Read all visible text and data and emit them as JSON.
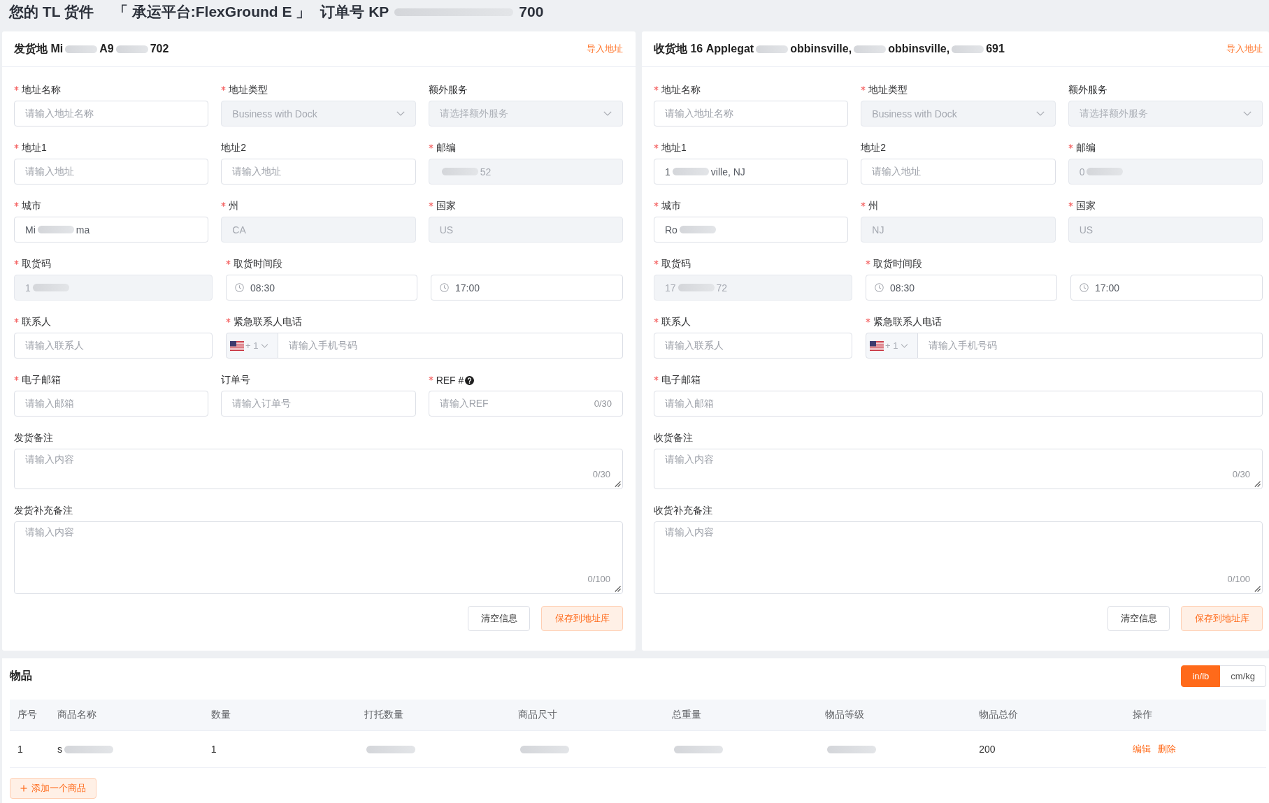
{
  "title": [
    {
      "kind": "text",
      "text": "您的 TL 货件"
    },
    {
      "kind": "text",
      "text": "「 承运平台:FlexGround E 」"
    },
    {
      "kind": "text",
      "text": "订单号 KP"
    },
    {
      "kind": "smear"
    },
    {
      "kind": "text",
      "text": "700"
    }
  ],
  "panels": [
    {
      "header": [
        {
          "kind": "text",
          "text": "发货地 Mi"
        },
        {
          "kind": "smear"
        },
        {
          "kind": "text",
          "text": "A9"
        },
        {
          "kind": "smear"
        },
        {
          "kind": "text",
          "text": "702"
        }
      ],
      "import_link": "导入地址",
      "rows": [
        [
          {
            "kind": "input",
            "label": "地址名称",
            "required": true,
            "disabled": false,
            "placeholder": "请输入地址名称"
          },
          {
            "kind": "select",
            "label": "地址类型",
            "required": true,
            "disabled": true,
            "value": "Business with Dock"
          },
          {
            "kind": "select",
            "label": "额外服务",
            "required": false,
            "disabled": true,
            "placeholder": "请选择额外服务"
          }
        ],
        [
          {
            "kind": "input",
            "label": "地址1",
            "required": true,
            "disabled": false,
            "placeholder": "请输入地址"
          },
          {
            "kind": "input",
            "label": "地址2",
            "required": false,
            "disabled": false,
            "placeholder": "请输入地址"
          },
          {
            "kind": "input",
            "label": "邮编",
            "required": true,
            "disabled": true,
            "value": [
              {
                "kind": "smear"
              },
              {
                "kind": "text",
                "text": "52"
              }
            ]
          }
        ],
        [
          {
            "kind": "input",
            "label": "城市",
            "required": true,
            "disabled": false,
            "value": [
              {
                "kind": "text",
                "text": "Mi"
              },
              {
                "kind": "smear"
              },
              {
                "kind": "text",
                "text": "ma"
              }
            ]
          },
          {
            "kind": "input",
            "label": "州",
            "required": true,
            "disabled": true,
            "value": "CA"
          },
          {
            "kind": "input",
            "label": "国家",
            "required": true,
            "disabled": true,
            "value": "US"
          }
        ],
        [
          {
            "kind": "input",
            "label": "取货码",
            "required": true,
            "disabled": true,
            "value": [
              {
                "kind": "text",
                "text": "1"
              },
              {
                "kind": "smear"
              }
            ]
          },
          {
            "kind": "time",
            "label": "取货时间段",
            "required": true,
            "disabled": false,
            "value": "08:30"
          },
          {
            "kind": "time",
            "disabled": false,
            "value": "17:00"
          }
        ],
        [
          {
            "kind": "input",
            "label": "联系人",
            "required": true,
            "disabled": false,
            "placeholder": "请输入联系人"
          },
          {
            "kind": "phone",
            "label": "紧急联系人电话",
            "required": true,
            "disabled": false,
            "code": "+ 1",
            "placeholder": "请输入手机号码"
          }
        ],
        [
          {
            "kind": "input",
            "label": "电子邮箱",
            "required": true,
            "disabled": false,
            "placeholder": "请输入邮箱"
          },
          {
            "kind": "input",
            "label": "订单号",
            "required": false,
            "disabled": false,
            "placeholder": "请输入订单号"
          },
          {
            "kind": "input",
            "label": "REF #",
            "required": true,
            "help": true,
            "disabled": false,
            "placeholder": "请输入REF",
            "counter": "0/30"
          }
        ]
      ],
      "notes": [
        {
          "label": "发货备注",
          "placeholder": "请输入内容",
          "counter": "0/30"
        },
        {
          "label": "发货补充备注",
          "placeholder": "请输入内容",
          "counter": "0/100"
        }
      ],
      "buttons": [
        {
          "kind": "clear",
          "label": "清空信息"
        },
        {
          "kind": "save",
          "label": "保存到地址库"
        }
      ]
    },
    {
      "header": [
        {
          "kind": "text",
          "text": "收货地 16 Applegat"
        },
        {
          "kind": "smear"
        },
        {
          "kind": "text",
          "text": "obbinsville,"
        },
        {
          "kind": "smear"
        },
        {
          "kind": "text",
          "text": "obbinsville,"
        },
        {
          "kind": "smear"
        },
        {
          "kind": "text",
          "text": "691"
        }
      ],
      "import_link": "导入地址",
      "rows": [
        [
          {
            "kind": "input",
            "label": "地址名称",
            "required": true,
            "disabled": false,
            "placeholder": "请输入地址名称"
          },
          {
            "kind": "select",
            "label": "地址类型",
            "required": true,
            "disabled": true,
            "value": "Business with Dock"
          },
          {
            "kind": "select",
            "label": "额外服务",
            "required": false,
            "disabled": true,
            "placeholder": "请选择额外服务"
          }
        ],
        [
          {
            "kind": "input",
            "label": "地址1",
            "required": true,
            "disabled": false,
            "value": [
              {
                "kind": "text",
                "text": "1"
              },
              {
                "kind": "smear"
              },
              {
                "kind": "text",
                "text": "ville, NJ"
              }
            ]
          },
          {
            "kind": "input",
            "label": "地址2",
            "required": false,
            "disabled": false,
            "placeholder": "请输入地址"
          },
          {
            "kind": "input",
            "label": "邮编",
            "required": true,
            "disabled": true,
            "value": [
              {
                "kind": "text",
                "text": "0"
              },
              {
                "kind": "smear"
              }
            ]
          }
        ],
        [
          {
            "kind": "input",
            "label": "城市",
            "required": true,
            "disabled": false,
            "value": [
              {
                "kind": "text",
                "text": "Ro"
              },
              {
                "kind": "smear"
              }
            ]
          },
          {
            "kind": "input",
            "label": "州",
            "required": true,
            "disabled": true,
            "value": "NJ"
          },
          {
            "kind": "input",
            "label": "国家",
            "required": true,
            "disabled": true,
            "value": "US"
          }
        ],
        [
          {
            "kind": "input",
            "label": "取货码",
            "required": true,
            "disabled": true,
            "value": [
              {
                "kind": "text",
                "text": "17"
              },
              {
                "kind": "smear"
              },
              {
                "kind": "text",
                "text": "72"
              }
            ]
          },
          {
            "kind": "time",
            "label": "取货时间段",
            "required": true,
            "disabled": false,
            "value": "08:30"
          },
          {
            "kind": "time",
            "disabled": false,
            "value": "17:00"
          }
        ],
        [
          {
            "kind": "input",
            "label": "联系人",
            "required": true,
            "disabled": false,
            "placeholder": "请输入联系人"
          },
          {
            "kind": "phone",
            "label": "紧急联系人电话",
            "required": true,
            "disabled": false,
            "code": "+ 1",
            "placeholder": "请输入手机号码"
          }
        ],
        [
          {
            "kind": "input",
            "label": "电子邮箱",
            "required": true,
            "disabled": false,
            "placeholder": "请输入邮箱"
          }
        ]
      ],
      "notes": [
        {
          "label": "收货备注",
          "placeholder": "请输入内容",
          "counter": "0/30"
        },
        {
          "label": "收货补充备注",
          "placeholder": "请输入内容",
          "counter": "0/100"
        }
      ],
      "buttons": [
        {
          "kind": "clear",
          "label": "清空信息"
        },
        {
          "kind": "save",
          "label": "保存到地址库"
        }
      ]
    }
  ],
  "items": {
    "title": "物品",
    "units": [
      {
        "label": "in/lb",
        "selected": true
      },
      {
        "label": "cm/kg",
        "selected": false
      }
    ],
    "columns": [
      "序号",
      "商品名称",
      "数量",
      "打托数量",
      "商品尺寸",
      "总重量",
      "物品等级",
      "物品总价",
      "操作"
    ],
    "rows": [
      [
        {
          "kind": "text",
          "text": "1"
        },
        {
          "kind": "redacted",
          "parts": [
            {
              "kind": "text",
              "text": "s"
            },
            {
              "kind": "smear"
            }
          ]
        },
        {
          "kind": "text",
          "text": "1"
        },
        {
          "kind": "redacted",
          "parts": [
            {
              "kind": "smear"
            }
          ]
        },
        {
          "kind": "redacted",
          "parts": [
            {
              "kind": "smear"
            }
          ]
        },
        {
          "kind": "redacted",
          "parts": [
            {
              "kind": "smear"
            }
          ]
        },
        {
          "kind": "redacted",
          "parts": [
            {
              "kind": "smear"
            }
          ]
        },
        {
          "kind": "text",
          "text": "200"
        },
        {
          "kind": "actions",
          "links": [
            "编辑",
            "删除"
          ]
        }
      ]
    ],
    "add_button": "添加一个商品"
  }
}
